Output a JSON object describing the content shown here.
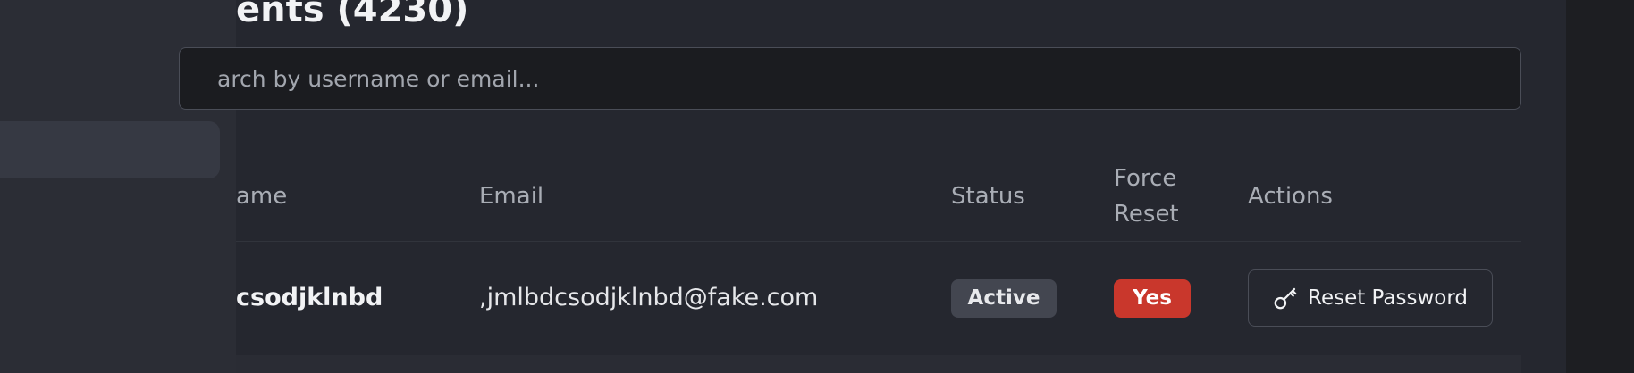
{
  "page": {
    "title": "ents (4230)"
  },
  "search": {
    "placeholder": "arch by username or email..."
  },
  "table": {
    "headers": {
      "username": "ame",
      "email": "Email",
      "status": "Status",
      "force_reset_line1": "Force",
      "force_reset_line2": "Reset",
      "actions": "Actions"
    },
    "rows": [
      {
        "username": "csodjklnbd",
        "email": ",jmlbdcsodjklnbd@fake.com",
        "status": "Active",
        "force_reset": "Yes",
        "action_label": "Reset Password",
        "action_icon": "key-icon"
      }
    ]
  },
  "colors": {
    "status_badge": "#434650",
    "force_reset_badge": "#c9372c",
    "background": "#25272f",
    "sidebar": "#2b2d35"
  }
}
